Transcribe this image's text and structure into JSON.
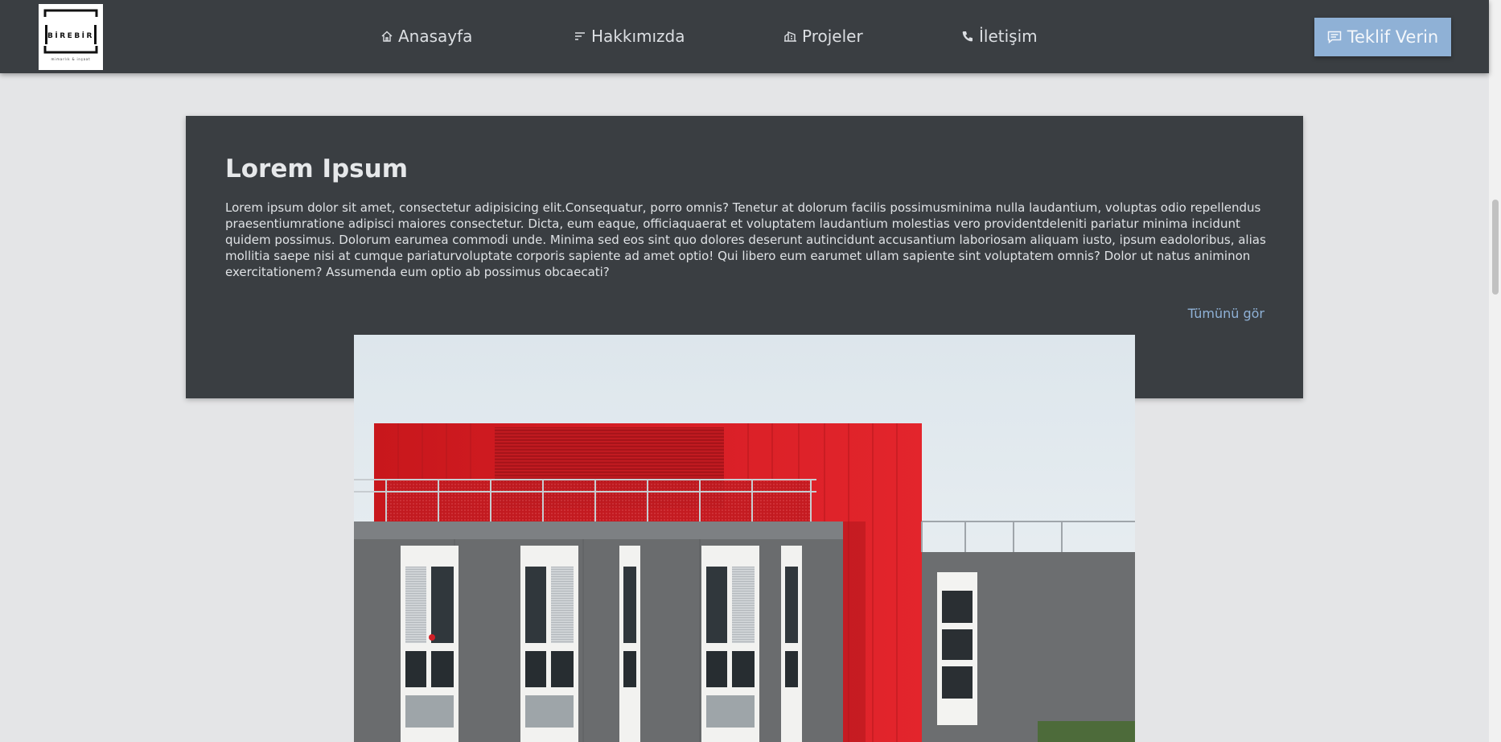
{
  "navbar": {
    "logo": {
      "text": "BİREBİR",
      "subtext": "mimarlık & inşaat"
    },
    "items": [
      {
        "label": "Anasayfa",
        "icon": "home-icon"
      },
      {
        "label": "Hakkımızda",
        "icon": "list-icon"
      },
      {
        "label": "Projeler",
        "icon": "building-icon"
      },
      {
        "label": "İletişim",
        "icon": "phone-icon"
      }
    ],
    "cta": {
      "label": "Teklif Verin",
      "icon": "message-icon"
    }
  },
  "card": {
    "title": "Lorem Ipsum",
    "body": "Lorem ipsum dolor sit amet, consectetur adipisicing elit.Consequatur, porro omnis? Tenetur at dolorum facilis possimusminima nulla laudantium, voluptas odio repellendus praesentiumratione adipisci maiores consectetur. Dicta, eum eaque, officiaquaerat et voluptatem laudantium molestias vero providentdeleniti pariatur minima incidunt quidem possimus. Dolorum earumea commodi unde. Minima sed eos sint quo dolores deserunt autincidunt accusantium laboriosam aliquam iusto, ipsum eadoloribus, alias mollitia saepe nisi at cumque pariaturvoluptate corporis sapiente ad amet optio! Qui libero eum earumet ullam sapiente sint voluptatem omnis? Dolor ut natus animinon exercitationem? Assumenda eum optio ab possimus obcaecati?",
    "link_label": "Tümünü gör"
  },
  "colors": {
    "navbar_bg": "#3a3e42",
    "page_bg": "#e4e5e7",
    "accent": "#8fb1d6",
    "card_bg": "#3a3e42",
    "facade_red": "#d81f26"
  }
}
